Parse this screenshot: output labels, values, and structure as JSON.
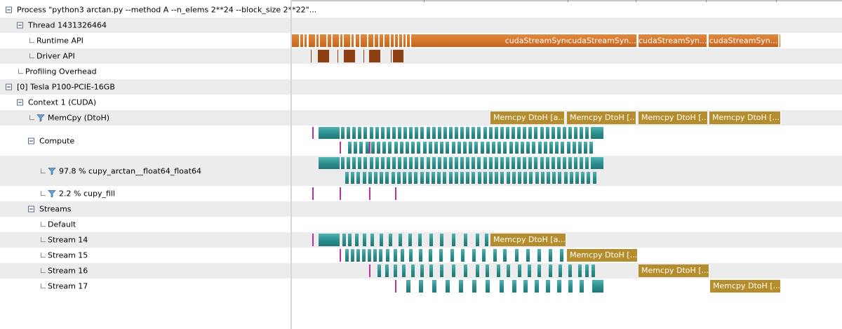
{
  "tree": {
    "rows": [
      {
        "label": "Process \"python3 arctan.py --method A --n_elems 2**24 --block_size 2**22\"...",
        "expander": true
      },
      {
        "label": "Thread 1431326464",
        "expander": true
      },
      {
        "label": "Runtime API",
        "expander": false
      },
      {
        "label": "Driver API",
        "expander": false
      },
      {
        "label": "Profiling Overhead",
        "expander": false
      },
      {
        "label": "[0] Tesla P100-PCIE-16GB",
        "expander": true
      },
      {
        "label": "Context 1 (CUDA)",
        "expander": true
      },
      {
        "label": "MemCpy (DtoH)",
        "expander": false,
        "icon": "filter-icon"
      },
      {
        "label": "Compute",
        "expander": true
      },
      {
        "label": "97.8 % cupy_arctan__float64_float64",
        "expander": false,
        "icon": "filter-icon"
      },
      {
        "label": "2.2 % cupy_fill",
        "expander": false,
        "icon": "filter-icon"
      },
      {
        "label": "Streams",
        "expander": true
      },
      {
        "label": "Default",
        "expander": false
      },
      {
        "label": "Stream 14",
        "expander": false
      },
      {
        "label": "Stream 15",
        "expander": false
      },
      {
        "label": "Stream 16",
        "expander": false
      },
      {
        "label": "Stream 17",
        "expander": false
      }
    ]
  },
  "timeline": {
    "runtime_api_labels": [
      "cudaStreamSynchronize",
      "cudaStreamSyn...",
      "cudaStreamSyn...",
      "cudaStreamSyn..."
    ],
    "memcpy_labels": [
      "Memcpy DtoH [a...",
      "Memcpy DtoH [...",
      "Memcpy DtoH [...",
      "Memcpy DtoH [..."
    ],
    "stream_memcpy_labels": {
      "stream14": "Memcpy DtoH [a...",
      "stream15": "Memcpy DtoH [...",
      "stream16": "Memcpy DtoH [...",
      "stream17": "Memcpy DtoH [..."
    }
  },
  "colors": {
    "runtime_api": "#d7772c",
    "driver_api": "#8e3f12",
    "memcpy": "#b58d2d",
    "kernel": "#3a9e9e",
    "fill_kernel": "#b8339e",
    "alt_row": "#ececec"
  }
}
